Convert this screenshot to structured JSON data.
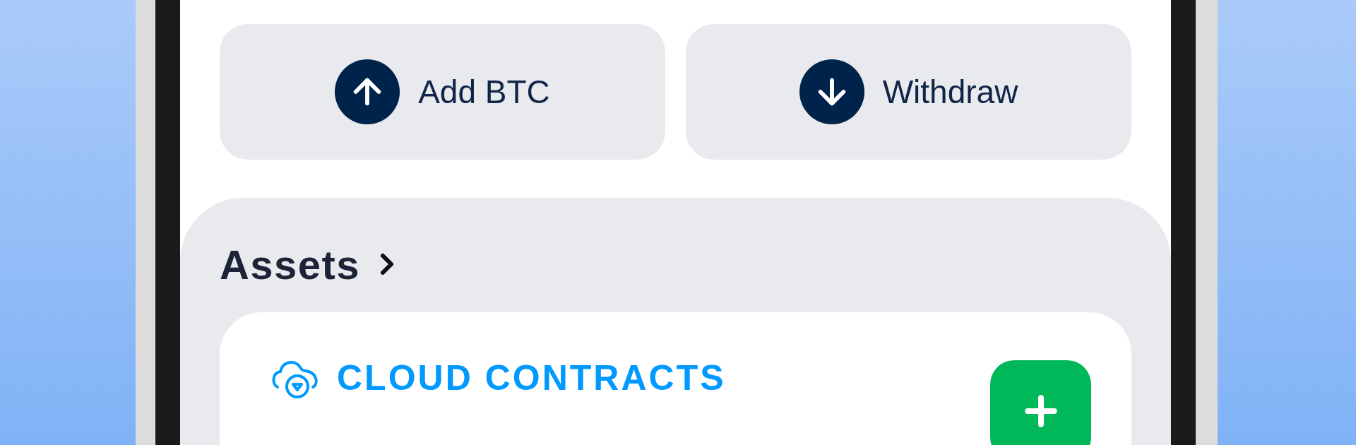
{
  "actions": [
    {
      "label": "Add BTC",
      "kind": "deposit"
    },
    {
      "label": "Withdraw",
      "kind": "withdraw"
    }
  ],
  "assets": {
    "title": "Assets",
    "card": {
      "title": "CLOUD CONTRACTS"
    }
  }
}
